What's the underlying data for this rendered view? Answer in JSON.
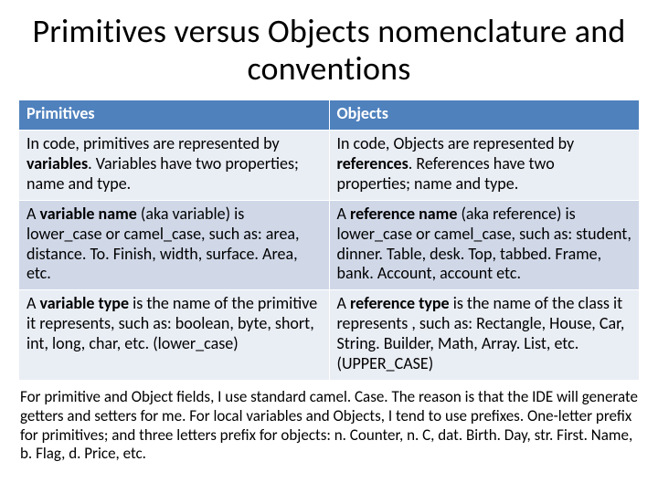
{
  "title": "Primitives versus Objects nomenclature and conventions",
  "headers": {
    "left": "Primitives",
    "right": "Objects"
  },
  "rows": [
    {
      "left_pre": "In code, primitives are represented by ",
      "left_bold": "variables",
      "left_post": ". Variables have two properties; name and type.",
      "right_pre": "In code, Objects are represented by ",
      "right_bold": "references",
      "right_post": ". References have two properties; name and type."
    },
    {
      "left_pre": "A ",
      "left_bold": "variable name",
      "left_post": " (aka variable) is lower_case or camel_case,  such as: area, distance. To. Finish, width, surface. Area, etc.",
      "right_pre": "A ",
      "right_bold": "reference name",
      "right_post": " (aka reference) is lower_case or camel_case,  such as: student, dinner. Table, desk. Top, tabbed. Frame, bank. Account, account etc."
    },
    {
      "left_pre": "A ",
      "left_bold": "variable type",
      "left_post": " is the name of the primitive it represents, such as: boolean, byte, short, int, long, char, etc. (lower_case)",
      "right_pre": "A ",
      "right_bold": "reference type",
      "right_post": " is the name of the class it represents , such as: Rectangle, House, Car, String. Builder, Math, Array. List, etc. (UPPER_CASE)"
    }
  ],
  "footer": "For primitive and Object fields, I use standard camel. Case. The reason is that the IDE will generate getters and setters for me. For local variables and Objects, I  tend to use prefixes. One-letter prefix for primitives; and three letters prefix for objects:  n. Counter, n. C, dat. Birth. Day, str. First. Name, b. Flag, d. Price, etc."
}
